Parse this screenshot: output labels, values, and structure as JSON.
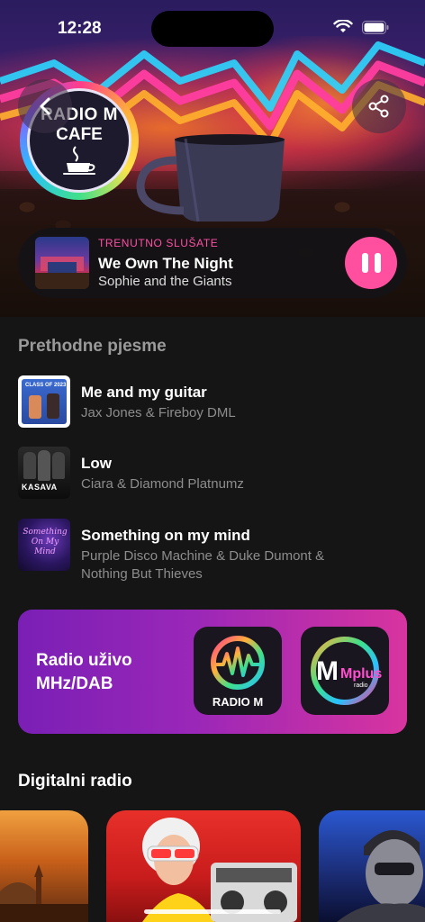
{
  "status_bar": {
    "time": "12:28"
  },
  "hero": {
    "logo_line1": "RADIO M",
    "logo_line2": "CAFE",
    "back_icon": "chevron-left-icon",
    "share_icon": "share-icon"
  },
  "now_playing": {
    "label": "TRENUTNO SLUŠATE",
    "title": "We Own The Night",
    "artist": "Sophie and the Giants",
    "pause_icon": "pause-icon",
    "accent": "#ff4f9e"
  },
  "previous": {
    "heading": "Prethodne pjesme",
    "songs": [
      {
        "title": "Me and my guitar",
        "artist": "Jax Jones & Fireboy DML",
        "art_text": "CLASS OF 2023"
      },
      {
        "title": "Low",
        "artist": "Ciara & Diamond Platnumz",
        "art_text": "KASAVA"
      },
      {
        "title": "Something on my mind",
        "artist": "Purple Disco Machine & Duke Dumont & Nothing But Thieves",
        "art_text": "Something On My Mind"
      }
    ]
  },
  "live_banner": {
    "line1": "Radio uživo",
    "line2": "MHz/DAB",
    "stations": [
      {
        "label": "RADIO M"
      },
      {
        "label": "Mplus",
        "sub": "radio"
      }
    ]
  },
  "digital": {
    "heading": "Digitalni radio"
  }
}
